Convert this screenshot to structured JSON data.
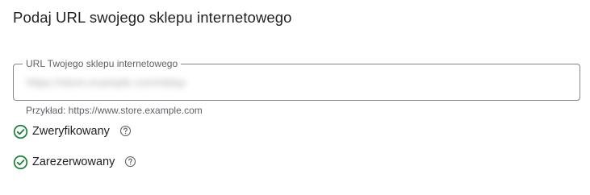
{
  "heading": "Podaj URL swojego sklepu internetowego",
  "url_field": {
    "label": "URL Twojego sklepu internetowego",
    "value": "https://store.example.com/sklep"
  },
  "hint": "Przykład: https://www.store.example.com",
  "statuses": [
    {
      "label": "Zweryfikowany",
      "icon": "check-circle-icon",
      "help_icon": "help-icon"
    },
    {
      "label": "Zarezerwowany",
      "icon": "check-circle-icon",
      "help_icon": "help-icon"
    }
  ],
  "colors": {
    "success": "#188038",
    "text": "#202124",
    "secondary_text": "#5f6368",
    "border": "#80868b"
  }
}
